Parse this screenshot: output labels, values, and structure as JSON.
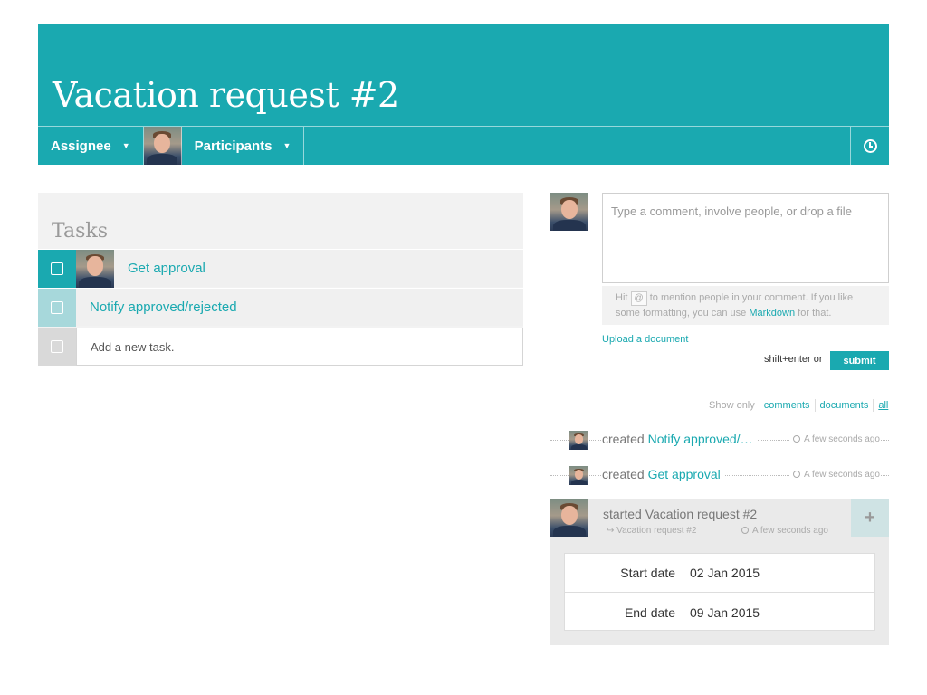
{
  "header": {
    "title": "Vacation request #2",
    "assignee_label": "Assignee",
    "participants_label": "Participants",
    "accent_color": "#1aa9b0"
  },
  "tasks": {
    "title": "Tasks",
    "items": [
      {
        "label": "Get approval",
        "has_avatar": true
      },
      {
        "label": "Notify approved/rejected",
        "has_avatar": false
      }
    ],
    "new_task_placeholder": "Add a new task."
  },
  "comment": {
    "placeholder": "Type a comment, involve people, or drop a file",
    "hint_before": "Hit",
    "hint_at": "@",
    "hint_middle": "to mention people in your comment. If you like some formatting, you can use",
    "hint_link": "Markdown",
    "hint_after": "for that.",
    "upload_label": "Upload a document",
    "shortcut_text": "shift+enter or",
    "submit_label": "submit"
  },
  "filter": {
    "label": "Show only",
    "options": [
      "comments",
      "documents",
      "all"
    ],
    "active": "all"
  },
  "activity": [
    {
      "verb": "created",
      "target": "Notify approved/…",
      "time": "A few seconds ago"
    },
    {
      "verb": "created",
      "target": "Get approval",
      "time": "A few seconds ago"
    }
  ],
  "started": {
    "title": "started Vacation request #2",
    "sub": "Vacation request #2",
    "time": "A few seconds ago",
    "plus": "+",
    "fields": [
      {
        "label": "Start date",
        "value": "02 Jan 2015"
      },
      {
        "label": "End date",
        "value": "09 Jan 2015"
      }
    ]
  }
}
